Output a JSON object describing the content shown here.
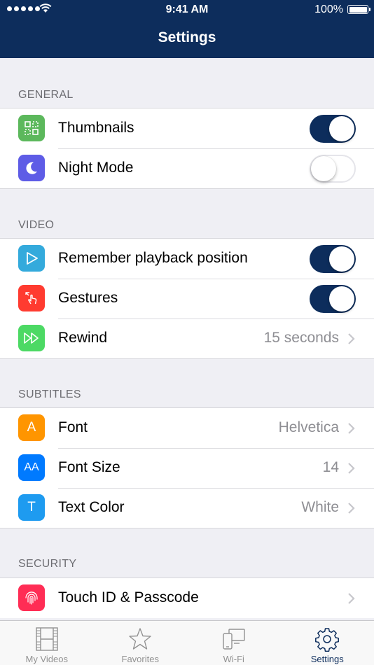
{
  "status": {
    "time": "9:41 AM",
    "battery": "100%"
  },
  "nav": {
    "title": "Settings"
  },
  "sections": [
    {
      "header": "GENERAL",
      "rows": [
        {
          "label": "Thumbnails",
          "icon": "thumbnails-icon",
          "icon_color": "#5cb85c",
          "toggle": "on"
        },
        {
          "label": "Night Mode",
          "icon": "moon-icon",
          "icon_color": "#5e5ce6",
          "toggle": "off"
        }
      ]
    },
    {
      "header": "VIDEO",
      "rows": [
        {
          "label": "Remember playback position",
          "icon": "play-icon",
          "icon_color": "#34aadc",
          "toggle": "on"
        },
        {
          "label": "Gestures",
          "icon": "gesture-icon",
          "icon_color": "#ff3b30",
          "toggle": "on"
        },
        {
          "label": "Rewind",
          "icon": "fast-forward-icon",
          "icon_color": "#4cd964",
          "value": "15 seconds"
        }
      ]
    },
    {
      "header": "SUBTITLES",
      "rows": [
        {
          "label": "Font",
          "icon": "font-icon",
          "icon_text": "A",
          "icon_color": "#ff9500",
          "value": "Helvetica"
        },
        {
          "label": "Font Size",
          "icon": "font-size-icon",
          "icon_text": "AA",
          "icon_color": "#007aff",
          "value": "14"
        },
        {
          "label": "Text Color",
          "icon": "text-color-icon",
          "icon_text": "T",
          "icon_color": "#1e9bf0",
          "value": "White"
        }
      ]
    },
    {
      "header": "SECURITY",
      "rows": [
        {
          "label": "Touch ID & Passcode",
          "icon": "fingerprint-icon",
          "icon_color": "#ff2d55"
        }
      ]
    }
  ],
  "tabs": [
    {
      "label": "My Videos",
      "icon": "film-icon"
    },
    {
      "label": "Favorites",
      "icon": "star-icon"
    },
    {
      "label": "Wi-Fi",
      "icon": "devices-icon"
    },
    {
      "label": "Settings",
      "icon": "gear-icon",
      "active": true
    }
  ],
  "colors": {
    "nav_bar": "#0d2d5c",
    "toggle_on": "#0d2d5c",
    "background": "#efeff4"
  }
}
